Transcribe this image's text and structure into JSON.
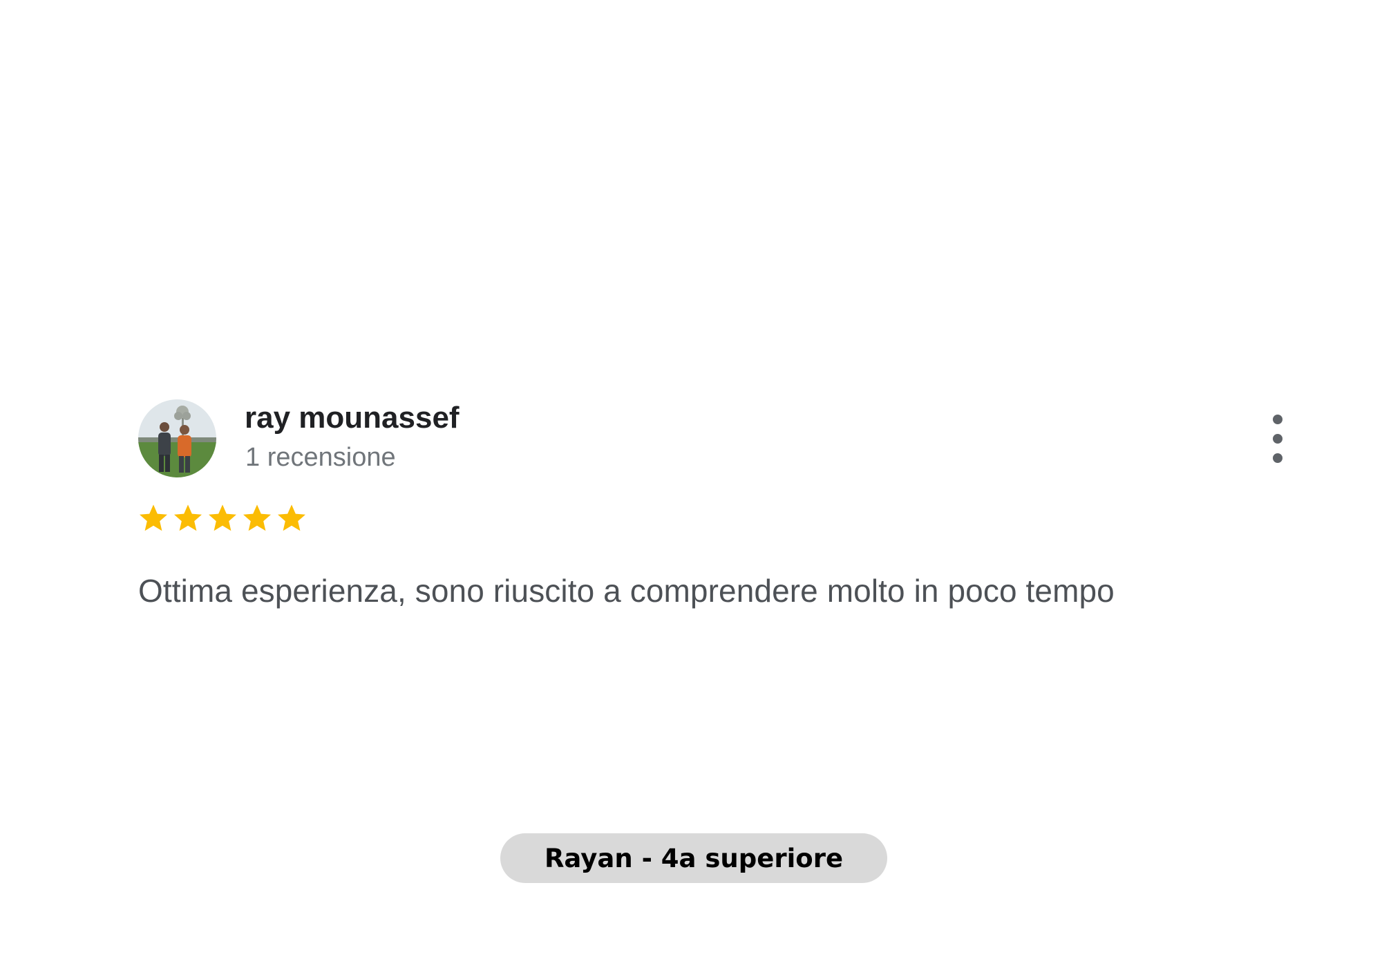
{
  "review": {
    "reviewer_name": "ray mounassef",
    "review_count": "1 recensione",
    "rating": 5,
    "rating_max": 5,
    "text": "Ottima esperienza, sono riuscito a comprendere molto in poco tempo",
    "more_icon": "more-vert-icon"
  },
  "caption": {
    "label": "Rayan - 4a superiore"
  },
  "colors": {
    "star": "#fbbc04",
    "name": "#202124",
    "secondary_text": "#70757a",
    "review_text": "#4d5156",
    "pill_background": "#d9d9d9"
  }
}
